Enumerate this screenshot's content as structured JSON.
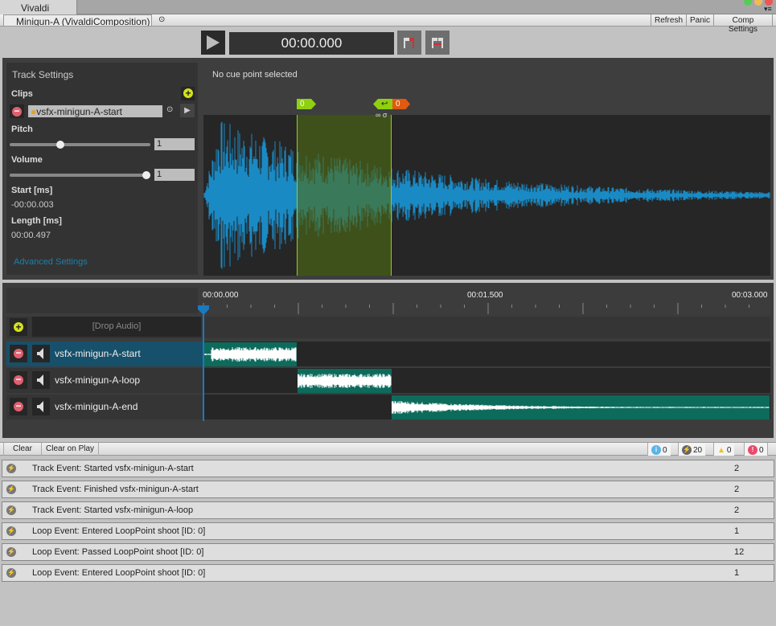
{
  "window": {
    "app_title": "Vivaldi",
    "document_tab": "Minigun-A (VivaldiComposition)"
  },
  "toolbar": {
    "refresh": "Refresh",
    "panic": "Panic",
    "comp_settings": "Comp Settings"
  },
  "transport": {
    "time": "00:00.000"
  },
  "track_settings": {
    "title": "Track Settings",
    "clips_label": "Clips",
    "clip_name": "vsfx-minigun-A-start",
    "pitch_label": "Pitch",
    "pitch_value": "1",
    "pitch_slider": 0.35,
    "volume_label": "Volume",
    "volume_value": "1",
    "volume_slider": 1.0,
    "start_label": "Start [ms]",
    "start_value": "-00:00.003",
    "length_label": "Length [ms]",
    "length_value": "00:00.497",
    "advanced": "Advanced Settings"
  },
  "cue": {
    "status": "No cue point selected",
    "start_marker": "0",
    "loop_marker": "0",
    "loop_symbols": "∞ σ"
  },
  "timeline": {
    "ticks": [
      "00:00.000",
      "00:01.500",
      "00:03.000"
    ],
    "drop_audio": "[Drop Audio]",
    "tracks": [
      {
        "name": "vsfx-minigun-A-start",
        "selected": true
      },
      {
        "name": "vsfx-minigun-A-loop",
        "selected": false
      },
      {
        "name": "vsfx-minigun-A-end",
        "selected": false
      }
    ]
  },
  "log": {
    "clear": "Clear",
    "clear_on_play": "Clear on Play",
    "counts": {
      "info": "0",
      "event": "20",
      "warning": "0",
      "error": "0"
    },
    "entries": [
      {
        "message": "Track Event: Started vsfx-minigun-A-start",
        "count": "2"
      },
      {
        "message": "Track Event: Finished vsfx-minigun-A-start",
        "count": "2"
      },
      {
        "message": "Track Event: Started vsfx-minigun-A-loop",
        "count": "2"
      },
      {
        "message": "Loop Event: Entered LoopPoint shoot [ID: 0]",
        "count": "1"
      },
      {
        "message": "Loop Event: Passed LoopPoint shoot [ID: 0]",
        "count": "12"
      },
      {
        "message": "Loop Event: Entered LoopPoint shoot [ID: 0]",
        "count": "1"
      }
    ]
  },
  "colors": {
    "waveform": "#1a8ac4",
    "clip": "#0d6b5c",
    "accent": "#9acb20",
    "loop_end": "#e05a10",
    "playhead": "#1a7ac0"
  }
}
